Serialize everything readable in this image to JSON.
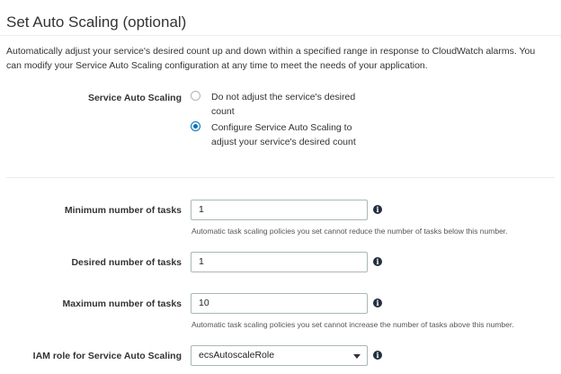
{
  "section": {
    "title": "Set Auto Scaling (optional)",
    "description": "Automatically adjust your service's desired count up and down within a specified range in response to CloudWatch alarms. You can modify your Service Auto Scaling configuration at any time to meet the needs of your application."
  },
  "service_auto_scaling": {
    "label": "Service Auto Scaling",
    "options": [
      {
        "label": "Do not adjust the service's desired count",
        "selected": false
      },
      {
        "label": "Configure Service Auto Scaling to adjust your service's desired count",
        "selected": true
      }
    ]
  },
  "fields": {
    "minimum": {
      "label": "Minimum number of tasks",
      "value": "1",
      "help": "Automatic task scaling policies you set cannot reduce the number of tasks below this number."
    },
    "desired": {
      "label": "Desired number of tasks",
      "value": "1"
    },
    "maximum": {
      "label": "Maximum number of tasks",
      "value": "10",
      "help": "Automatic task scaling policies you set cannot increase the number of tasks above this number."
    },
    "iam_role": {
      "label": "IAM role for Service Auto Scaling",
      "value": "ecsAutoscaleRole"
    }
  },
  "icons": {
    "info": "info-icon",
    "dropdown": "chevron-down-icon"
  },
  "colors": {
    "accent": "#0073bb",
    "border": "#aab7b8",
    "divider": "#eaeded",
    "icon": "#232f3e"
  }
}
